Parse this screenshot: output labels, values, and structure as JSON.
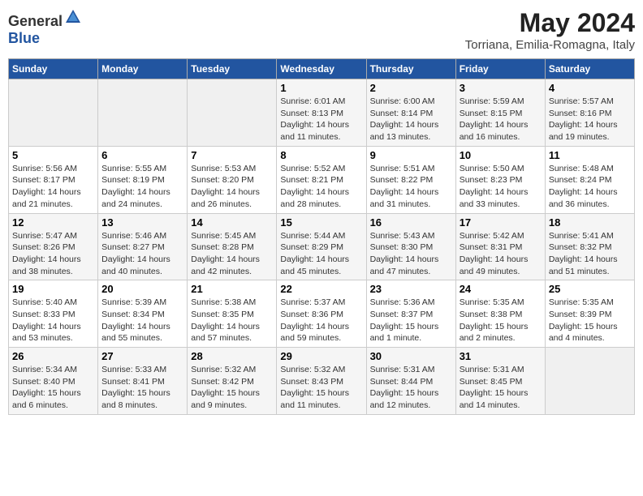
{
  "header": {
    "logo": {
      "general": "General",
      "blue": "Blue"
    },
    "month": "May 2024",
    "location": "Torriana, Emilia-Romagna, Italy"
  },
  "days_of_week": [
    "Sunday",
    "Monday",
    "Tuesday",
    "Wednesday",
    "Thursday",
    "Friday",
    "Saturday"
  ],
  "weeks": [
    [
      {
        "day": "",
        "sunrise": "",
        "sunset": "",
        "daylight": ""
      },
      {
        "day": "",
        "sunrise": "",
        "sunset": "",
        "daylight": ""
      },
      {
        "day": "",
        "sunrise": "",
        "sunset": "",
        "daylight": ""
      },
      {
        "day": "1",
        "sunrise": "Sunrise: 6:01 AM",
        "sunset": "Sunset: 8:13 PM",
        "daylight": "Daylight: 14 hours and 11 minutes."
      },
      {
        "day": "2",
        "sunrise": "Sunrise: 6:00 AM",
        "sunset": "Sunset: 8:14 PM",
        "daylight": "Daylight: 14 hours and 13 minutes."
      },
      {
        "day": "3",
        "sunrise": "Sunrise: 5:59 AM",
        "sunset": "Sunset: 8:15 PM",
        "daylight": "Daylight: 14 hours and 16 minutes."
      },
      {
        "day": "4",
        "sunrise": "Sunrise: 5:57 AM",
        "sunset": "Sunset: 8:16 PM",
        "daylight": "Daylight: 14 hours and 19 minutes."
      }
    ],
    [
      {
        "day": "5",
        "sunrise": "Sunrise: 5:56 AM",
        "sunset": "Sunset: 8:17 PM",
        "daylight": "Daylight: 14 hours and 21 minutes."
      },
      {
        "day": "6",
        "sunrise": "Sunrise: 5:55 AM",
        "sunset": "Sunset: 8:19 PM",
        "daylight": "Daylight: 14 hours and 24 minutes."
      },
      {
        "day": "7",
        "sunrise": "Sunrise: 5:53 AM",
        "sunset": "Sunset: 8:20 PM",
        "daylight": "Daylight: 14 hours and 26 minutes."
      },
      {
        "day": "8",
        "sunrise": "Sunrise: 5:52 AM",
        "sunset": "Sunset: 8:21 PM",
        "daylight": "Daylight: 14 hours and 28 minutes."
      },
      {
        "day": "9",
        "sunrise": "Sunrise: 5:51 AM",
        "sunset": "Sunset: 8:22 PM",
        "daylight": "Daylight: 14 hours and 31 minutes."
      },
      {
        "day": "10",
        "sunrise": "Sunrise: 5:50 AM",
        "sunset": "Sunset: 8:23 PM",
        "daylight": "Daylight: 14 hours and 33 minutes."
      },
      {
        "day": "11",
        "sunrise": "Sunrise: 5:48 AM",
        "sunset": "Sunset: 8:24 PM",
        "daylight": "Daylight: 14 hours and 36 minutes."
      }
    ],
    [
      {
        "day": "12",
        "sunrise": "Sunrise: 5:47 AM",
        "sunset": "Sunset: 8:26 PM",
        "daylight": "Daylight: 14 hours and 38 minutes."
      },
      {
        "day": "13",
        "sunrise": "Sunrise: 5:46 AM",
        "sunset": "Sunset: 8:27 PM",
        "daylight": "Daylight: 14 hours and 40 minutes."
      },
      {
        "day": "14",
        "sunrise": "Sunrise: 5:45 AM",
        "sunset": "Sunset: 8:28 PM",
        "daylight": "Daylight: 14 hours and 42 minutes."
      },
      {
        "day": "15",
        "sunrise": "Sunrise: 5:44 AM",
        "sunset": "Sunset: 8:29 PM",
        "daylight": "Daylight: 14 hours and 45 minutes."
      },
      {
        "day": "16",
        "sunrise": "Sunrise: 5:43 AM",
        "sunset": "Sunset: 8:30 PM",
        "daylight": "Daylight: 14 hours and 47 minutes."
      },
      {
        "day": "17",
        "sunrise": "Sunrise: 5:42 AM",
        "sunset": "Sunset: 8:31 PM",
        "daylight": "Daylight: 14 hours and 49 minutes."
      },
      {
        "day": "18",
        "sunrise": "Sunrise: 5:41 AM",
        "sunset": "Sunset: 8:32 PM",
        "daylight": "Daylight: 14 hours and 51 minutes."
      }
    ],
    [
      {
        "day": "19",
        "sunrise": "Sunrise: 5:40 AM",
        "sunset": "Sunset: 8:33 PM",
        "daylight": "Daylight: 14 hours and 53 minutes."
      },
      {
        "day": "20",
        "sunrise": "Sunrise: 5:39 AM",
        "sunset": "Sunset: 8:34 PM",
        "daylight": "Daylight: 14 hours and 55 minutes."
      },
      {
        "day": "21",
        "sunrise": "Sunrise: 5:38 AM",
        "sunset": "Sunset: 8:35 PM",
        "daylight": "Daylight: 14 hours and 57 minutes."
      },
      {
        "day": "22",
        "sunrise": "Sunrise: 5:37 AM",
        "sunset": "Sunset: 8:36 PM",
        "daylight": "Daylight: 14 hours and 59 minutes."
      },
      {
        "day": "23",
        "sunrise": "Sunrise: 5:36 AM",
        "sunset": "Sunset: 8:37 PM",
        "daylight": "Daylight: 15 hours and 1 minute."
      },
      {
        "day": "24",
        "sunrise": "Sunrise: 5:35 AM",
        "sunset": "Sunset: 8:38 PM",
        "daylight": "Daylight: 15 hours and 2 minutes."
      },
      {
        "day": "25",
        "sunrise": "Sunrise: 5:35 AM",
        "sunset": "Sunset: 8:39 PM",
        "daylight": "Daylight: 15 hours and 4 minutes."
      }
    ],
    [
      {
        "day": "26",
        "sunrise": "Sunrise: 5:34 AM",
        "sunset": "Sunset: 8:40 PM",
        "daylight": "Daylight: 15 hours and 6 minutes."
      },
      {
        "day": "27",
        "sunrise": "Sunrise: 5:33 AM",
        "sunset": "Sunset: 8:41 PM",
        "daylight": "Daylight: 15 hours and 8 minutes."
      },
      {
        "day": "28",
        "sunrise": "Sunrise: 5:32 AM",
        "sunset": "Sunset: 8:42 PM",
        "daylight": "Daylight: 15 hours and 9 minutes."
      },
      {
        "day": "29",
        "sunrise": "Sunrise: 5:32 AM",
        "sunset": "Sunset: 8:43 PM",
        "daylight": "Daylight: 15 hours and 11 minutes."
      },
      {
        "day": "30",
        "sunrise": "Sunrise: 5:31 AM",
        "sunset": "Sunset: 8:44 PM",
        "daylight": "Daylight: 15 hours and 12 minutes."
      },
      {
        "day": "31",
        "sunrise": "Sunrise: 5:31 AM",
        "sunset": "Sunset: 8:45 PM",
        "daylight": "Daylight: 15 hours and 14 minutes."
      },
      {
        "day": "",
        "sunrise": "",
        "sunset": "",
        "daylight": ""
      }
    ]
  ]
}
